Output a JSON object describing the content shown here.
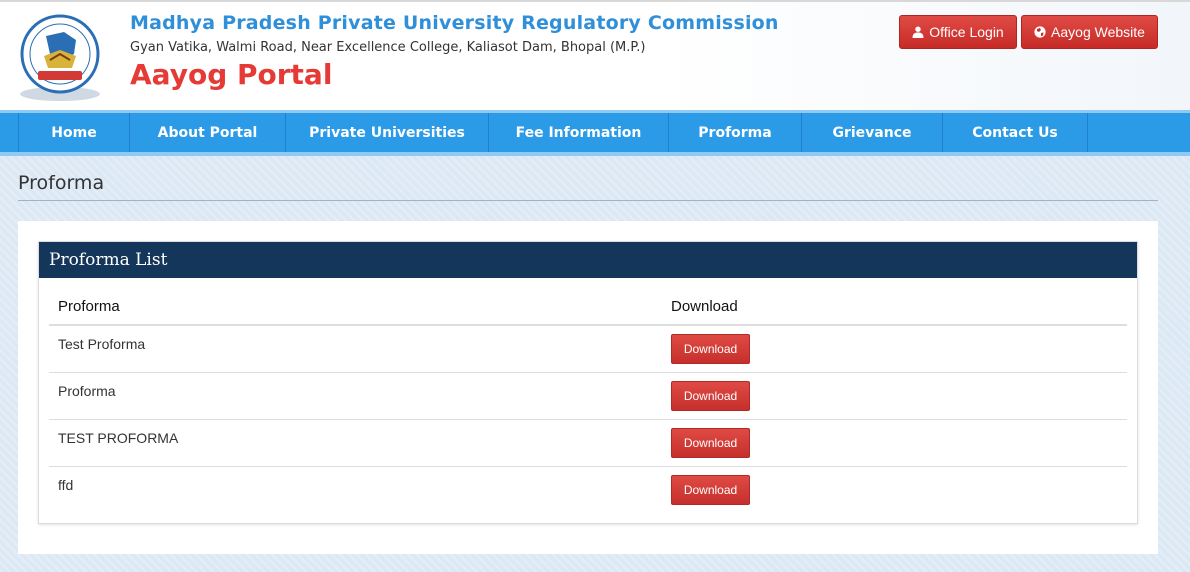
{
  "header": {
    "org_title": "Madhya Pradesh Private University Regulatory Commission",
    "address": "Gyan Vatika, Walmi Road, Near Excellence College, Kaliasot Dam, Bhopal (M.P.)",
    "portal_title": "Aayog Portal",
    "logo_icon": "commission-seal-logo",
    "buttons": [
      {
        "label": "Office Login",
        "icon": "user-icon"
      },
      {
        "label": "Aayog Website",
        "icon": "globe-icon"
      }
    ],
    "colors": {
      "title": "#2f8fd8",
      "portal": "#e53a35",
      "button": "#d23a35"
    }
  },
  "nav": {
    "items": [
      {
        "label": "Home"
      },
      {
        "label": "About Portal"
      },
      {
        "label": "Private Universities"
      },
      {
        "label": "Fee Information"
      },
      {
        "label": "Proforma"
      },
      {
        "label": "Grievance"
      },
      {
        "label": "Contact Us"
      }
    ],
    "color": "#2b9be8"
  },
  "page": {
    "title": "Proforma",
    "card_title": "Proforma List",
    "columns": [
      "Proforma",
      "Download"
    ],
    "rows": [
      {
        "name": "Test Proforma",
        "action": "Download"
      },
      {
        "name": "Proforma",
        "action": "Download"
      },
      {
        "name": "TEST PROFORMA",
        "action": "Download"
      },
      {
        "name": "ffd",
        "action": "Download"
      }
    ],
    "card_header_color": "#13365a"
  }
}
